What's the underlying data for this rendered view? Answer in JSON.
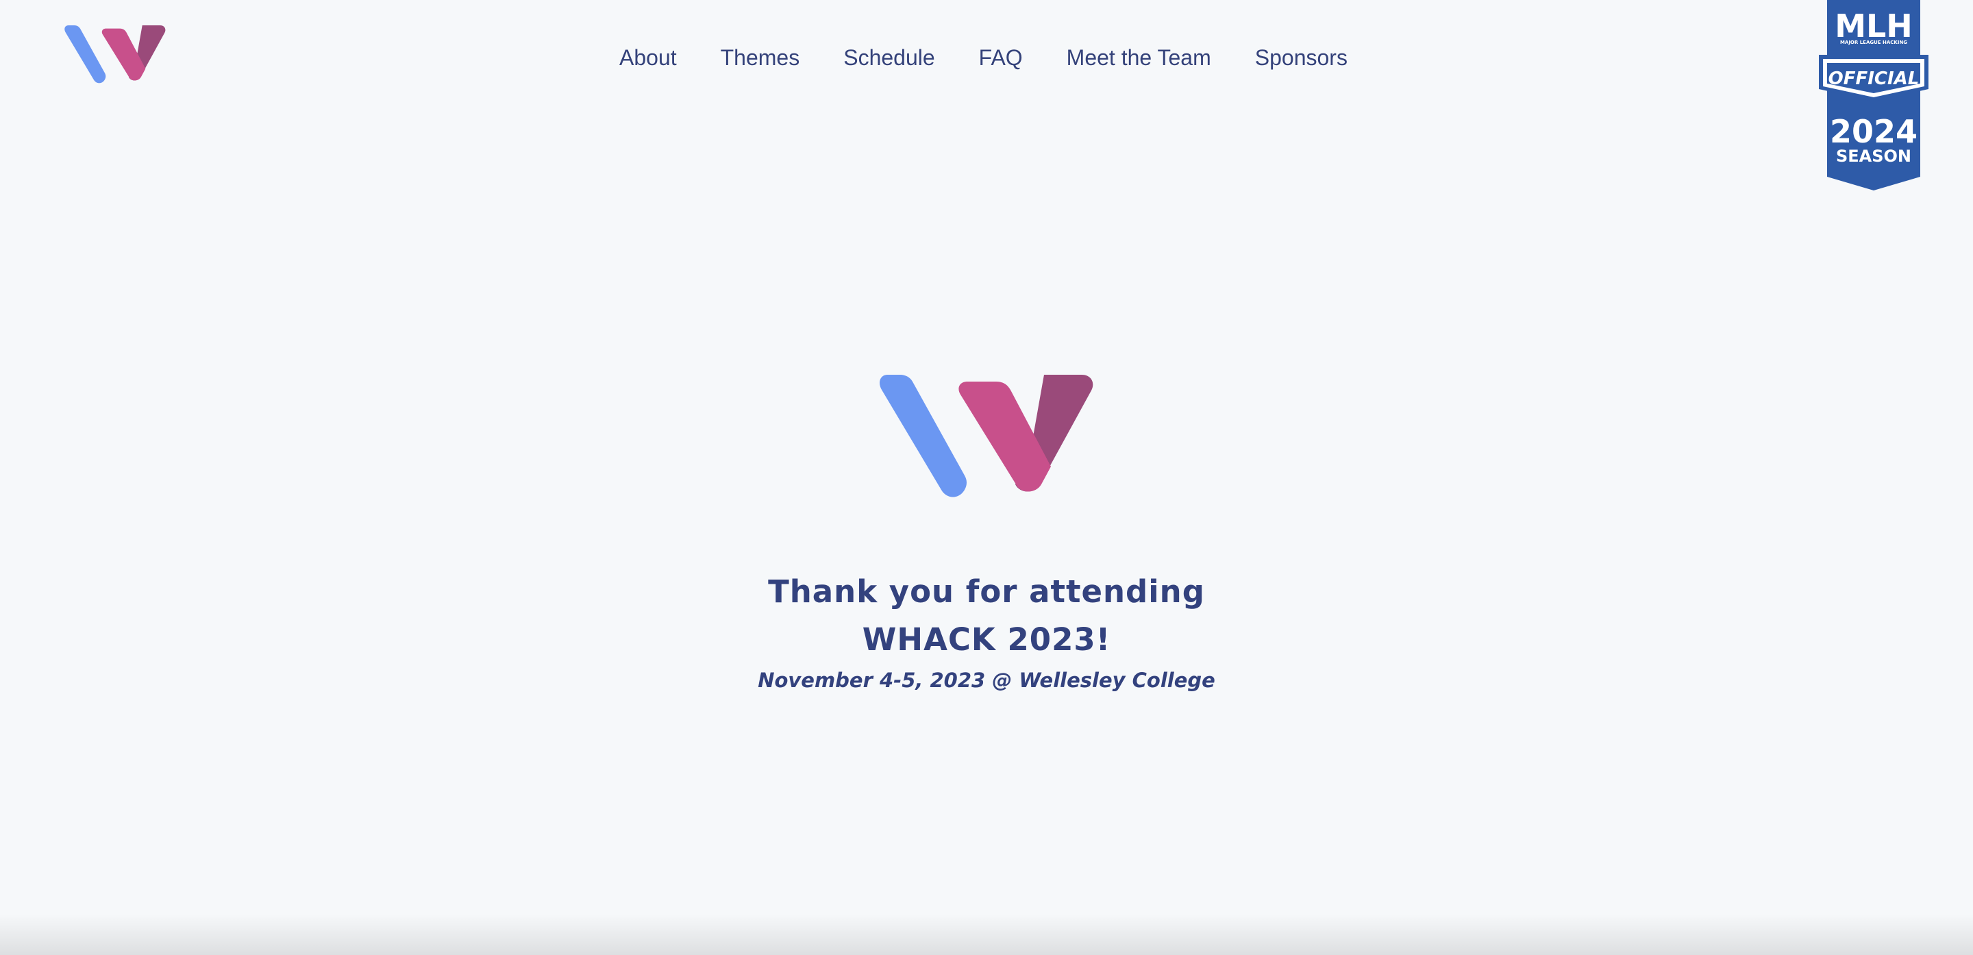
{
  "header": {
    "logo_icon": "whack-w-logo-icon",
    "nav": [
      {
        "label": "About"
      },
      {
        "label": "Themes"
      },
      {
        "label": "Schedule"
      },
      {
        "label": "FAQ"
      },
      {
        "label": "Meet the Team"
      },
      {
        "label": "Sponsors"
      }
    ]
  },
  "mlh_badge": {
    "title": "MLH",
    "subtitle": "MAJOR LEAGUE HACKING",
    "ribbon": "OFFICIAL",
    "year": "2024",
    "season": "SEASON",
    "color": "#2e5ba8"
  },
  "hero": {
    "logo_icon": "whack-w-logo-icon",
    "title_line1": "Thank you for attending",
    "title_line2": "WHACK 2023!",
    "subtitle": "November 4-5, 2023 @ Wellesley College"
  },
  "colors": {
    "background": "#f6f8fa",
    "text": "#33427e",
    "logo_blue": "#6b97f2",
    "logo_pink": "#c8508b",
    "logo_plum": "#9a4a7a"
  }
}
